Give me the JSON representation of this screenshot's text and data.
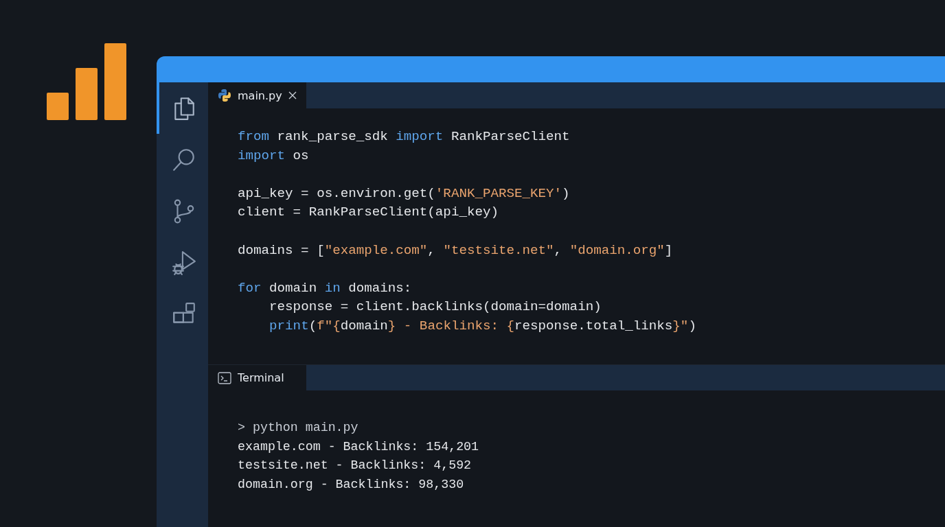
{
  "activity_bar": [
    {
      "kind": "files",
      "selected": true
    },
    {
      "kind": "search",
      "selected": false
    },
    {
      "kind": "source-control",
      "selected": false
    },
    {
      "kind": "run-debug",
      "selected": false
    },
    {
      "kind": "extensions",
      "selected": false
    }
  ],
  "editor_tabs": [
    {
      "label": "main.py",
      "selected": true
    }
  ],
  "code": [
    {
      "kind": "code",
      "tokens": [
        {
          "kind": "keyword",
          "text": "from"
        },
        {
          "kind": "plain",
          "text": " rank_parse_sdk "
        },
        {
          "kind": "keyword",
          "text": "import"
        },
        {
          "kind": "plain",
          "text": " RankParseClient"
        }
      ]
    },
    {
      "kind": "code",
      "tokens": [
        {
          "kind": "keyword",
          "text": "import"
        },
        {
          "kind": "plain",
          "text": " os"
        }
      ]
    },
    {
      "kind": "blank"
    },
    {
      "kind": "code",
      "tokens": [
        {
          "kind": "plain",
          "text": "api_key = os.environ.get("
        },
        {
          "kind": "string",
          "text": "'RANK_PARSE_KEY'"
        },
        {
          "kind": "plain",
          "text": ")"
        }
      ]
    },
    {
      "kind": "code",
      "tokens": [
        {
          "kind": "plain",
          "text": "client = RankParseClient(api_key)"
        }
      ]
    },
    {
      "kind": "blank"
    },
    {
      "kind": "code",
      "tokens": [
        {
          "kind": "plain",
          "text": "domains = ["
        },
        {
          "kind": "string",
          "text": "\"example.com\""
        },
        {
          "kind": "plain",
          "text": ", "
        },
        {
          "kind": "string",
          "text": "\"testsite.net\""
        },
        {
          "kind": "plain",
          "text": ", "
        },
        {
          "kind": "string",
          "text": "\"domain.org\""
        },
        {
          "kind": "plain",
          "text": "]"
        }
      ]
    },
    {
      "kind": "blank"
    },
    {
      "kind": "code",
      "tokens": [
        {
          "kind": "keyword",
          "text": "for"
        },
        {
          "kind": "plain",
          "text": " domain "
        },
        {
          "kind": "keyword",
          "text": "in"
        },
        {
          "kind": "plain",
          "text": " domains:"
        }
      ],
      "children": [
        {
          "kind": "code",
          "tokens": [
            {
              "kind": "plain",
              "text": "response = client.backlinks(domain=domain)"
            }
          ]
        },
        {
          "kind": "code",
          "tokens": [
            {
              "kind": "keyword",
              "text": "print"
            },
            {
              "kind": "plain",
              "text": "("
            },
            {
              "kind": "string",
              "text": "f\"{"
            },
            {
              "kind": "plain",
              "text": "domain"
            },
            {
              "kind": "string",
              "text": "} - Backlinks: {"
            },
            {
              "kind": "plain",
              "text": "response.total_links"
            },
            {
              "kind": "string",
              "text": "}\""
            },
            {
              "kind": "plain",
              "text": ")"
            }
          ]
        }
      ]
    }
  ],
  "panel_tabs": [
    {
      "label": "Terminal",
      "selected": true
    }
  ],
  "terminal": [
    {
      "kind": "command",
      "text": "> python main.py"
    },
    {
      "kind": "output",
      "text": "example.com - Backlinks: 154,201"
    },
    {
      "kind": "output",
      "text": "testsite.net - Backlinks: 4,592"
    },
    {
      "kind": "output",
      "text": "domain.org - Backlinks: 98,330"
    }
  ]
}
